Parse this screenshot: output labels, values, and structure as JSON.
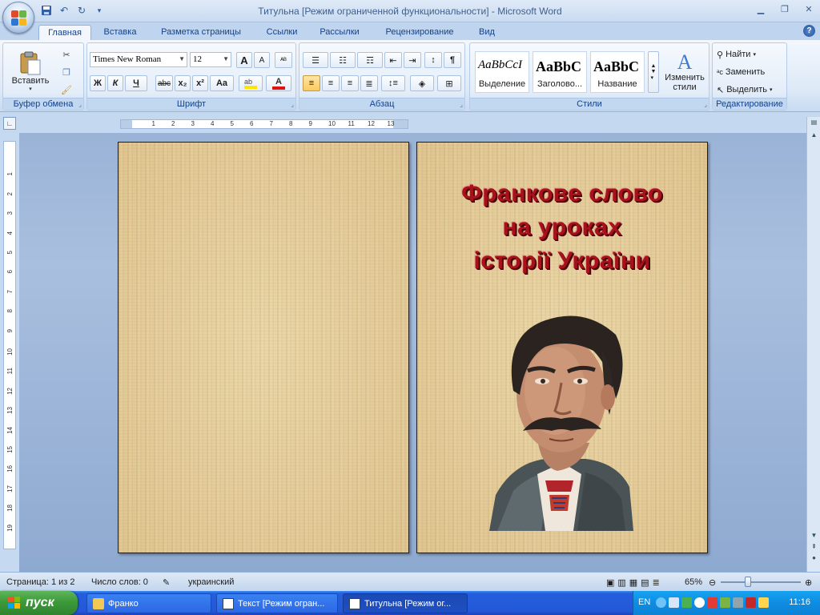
{
  "window": {
    "title": "Титульна [Режим ограниченной функциональности] - Microsoft Word"
  },
  "tabs": [
    {
      "label": "Главная",
      "active": true
    },
    {
      "label": "Вставка"
    },
    {
      "label": "Разметка страницы"
    },
    {
      "label": "Ссылки"
    },
    {
      "label": "Рассылки"
    },
    {
      "label": "Рецензирование"
    },
    {
      "label": "Вид"
    }
  ],
  "ribbon": {
    "clipboard": {
      "label": "Буфер обмена",
      "paste": "Вставить"
    },
    "font": {
      "label": "Шрифт",
      "font_name": "Times New Roman",
      "font_size": "12",
      "bold": "Ж",
      "italic": "К",
      "underline": "Ч",
      "strike": "abc",
      "sub": "x₂",
      "sup": "x²",
      "case": "Aa",
      "grow": "A",
      "shrink": "A"
    },
    "paragraph": {
      "label": "Абзац",
      "pilcrow": "¶"
    },
    "styles": {
      "label": "Стили",
      "items": [
        {
          "sample": "AaBbCcI",
          "name": "Выделение"
        },
        {
          "sample": "AaBbC",
          "name": "Заголово..."
        },
        {
          "sample": "AaBbC",
          "name": "Название"
        }
      ],
      "change": "Изменить",
      "change2": "стили"
    },
    "editing": {
      "label": "Редактирование",
      "find": "Найти",
      "replace": "Заменить",
      "select": "Выделить"
    }
  },
  "document": {
    "title_lines": [
      "Франкове слово",
      "на уроках",
      "історії України"
    ]
  },
  "statusbar": {
    "page": "Страница: 1 из 2",
    "words": "Число слов: 0",
    "language": "украинский",
    "zoom": "65%"
  },
  "taskbar": {
    "start": "пуск",
    "tasks": [
      {
        "label": "Франко"
      },
      {
        "label": "Текст [Режим огран..."
      },
      {
        "label": "Титульна [Режим ог...",
        "active": true
      }
    ],
    "lang": "EN",
    "clock": "11:16"
  },
  "colors": {
    "title_red": "#a8101a",
    "parchment": "#e6cf9e",
    "ribbon_blue": "#15428b"
  }
}
